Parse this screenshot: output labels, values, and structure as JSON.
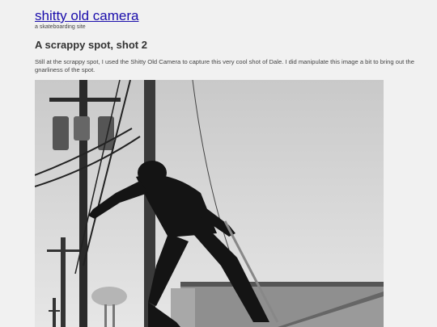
{
  "site": {
    "title": "shitty old camera",
    "tagline": "a skateboarding site"
  },
  "post": {
    "title": "A scrappy spot, shot 2",
    "body": "Still at the scrappy spot, I used the Shitty Old Camera to capture this very cool shot of Dale. I did manipulate this image a bit to bring out the gnarliness of the spot."
  },
  "photo": {
    "description_icon": "skateboarder-photo"
  }
}
